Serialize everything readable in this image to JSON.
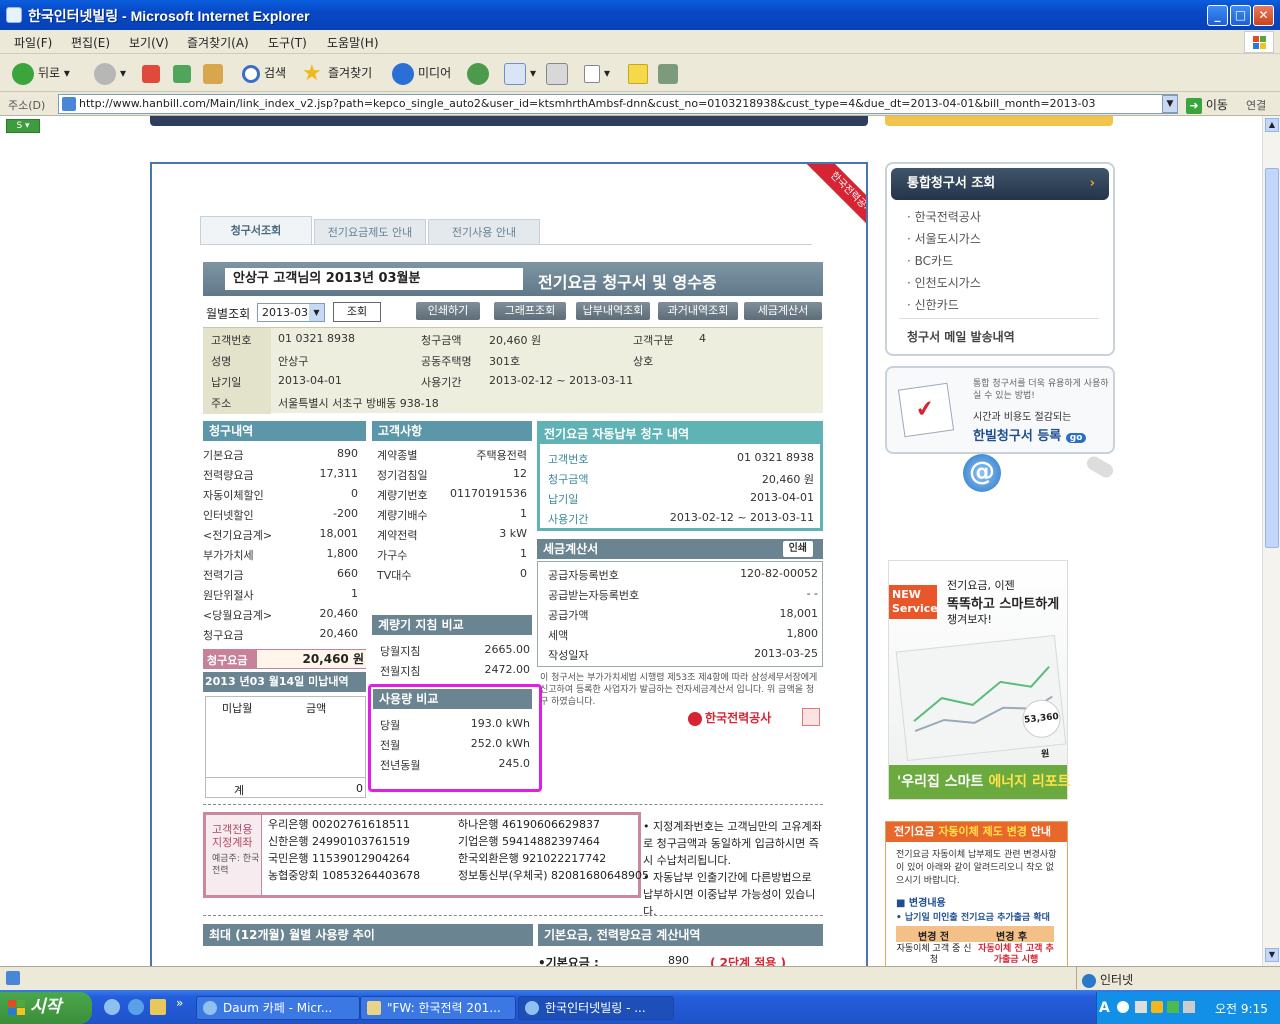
{
  "window": {
    "title": "한국인터넷빌링 - Microsoft Internet Explorer"
  },
  "menu": [
    "파일(F)",
    "편집(E)",
    "보기(V)",
    "즐겨찾기(A)",
    "도구(T)",
    "도움말(H)"
  ],
  "toolbar": {
    "back": "뒤로",
    "search": "검색",
    "favorites": "즐겨찾기",
    "media": "미디어"
  },
  "address": {
    "label": "주소(D)",
    "url": "http://www.hanbill.com/Main/link_index_v2.jsp?path=kepco_single_auto2&user_id=ktsmhrthAmbsf-dnn&cust_no=0103218938&cust_type=4&due_dt=2013-04-01&bill_month=2013-03",
    "go": "이동",
    "links": "연결"
  },
  "page": {
    "ribbon": "한국전력공사",
    "tabs": [
      "청구서조회",
      "전기요금제도 안내",
      "전기사용 안내"
    ],
    "title_customer": "안상구 고객님의 2013년 03월분",
    "title_doc": "전기요금 청구서 및 영수증",
    "month_label": "월별조회",
    "month_value": "2013-03",
    "query_btn": "조회",
    "actions": [
      "인쇄하기",
      "그래프조회",
      "납부내역조회",
      "과거내역조회",
      "세금계산서"
    ],
    "info": {
      "cust_no_label": "고객번호",
      "cust_no": "01 0321 8938",
      "bill_amt_label": "청구금액",
      "bill_amt": "20,460 원",
      "cust_type_label": "고객구분",
      "cust_type": "4",
      "name_label": "성명",
      "name": "안상구",
      "apt_label": "공동주택명",
      "apt": "301호",
      "shop_label": "상호",
      "shop": "",
      "due_label": "납기일",
      "due": "2013-04-01",
      "period_label": "사용기간",
      "period": "2013-02-12 ~ 2013-03-11",
      "addr_label": "주소",
      "addr": "서울특별시 서초구 방배동 938-18"
    },
    "charges": {
      "header": "청구내역",
      "rows": [
        {
          "label": "기본요금",
          "value": "890"
        },
        {
          "label": "전력량요금",
          "value": "17,311"
        },
        {
          "label": "자동이체할인",
          "value": "0"
        },
        {
          "label": "인터넷할인",
          "value": "-200"
        },
        {
          "label": "<전기요금계>",
          "value": "18,001"
        },
        {
          "label": "부가가치세",
          "value": "1,800"
        },
        {
          "label": "전력기금",
          "value": "660"
        },
        {
          "label": "원단위절사",
          "value": "1"
        },
        {
          "label": "<당월요금계>",
          "value": "20,460"
        },
        {
          "label": "청구요금",
          "value": "20,460"
        }
      ],
      "total_label": "청구요금",
      "total_value": "20,460 원",
      "unpaid_title": "2013 년03 월14일 미납내역",
      "unpaid_cols": [
        "미납월",
        "금액"
      ],
      "unpaid_sum_label": "계",
      "unpaid_sum_value": "0"
    },
    "customer": {
      "header": "고객사항",
      "rows": [
        {
          "label": "계약종별",
          "value": "주택용전력"
        },
        {
          "label": "정기검침일",
          "value": "12"
        },
        {
          "label": "계량기번호",
          "value": "01170191536"
        },
        {
          "label": "계량기배수",
          "value": "1"
        },
        {
          "label": "계약전력",
          "value": "3 kW"
        },
        {
          "label": "가구수",
          "value": "1"
        },
        {
          "label": "TV대수",
          "value": "0"
        }
      ]
    },
    "meter": {
      "header": "계량기 지침 비교",
      "rows": [
        {
          "label": "당월지침",
          "value": "2665.00"
        },
        {
          "label": "전월지침",
          "value": "2472.00"
        }
      ]
    },
    "usage": {
      "header": "사용량 비교",
      "rows": [
        {
          "label": "당월",
          "value": "193.0 kWh"
        },
        {
          "label": "전월",
          "value": "252.0 kWh"
        },
        {
          "label": "전년동월",
          "value": "245.0"
        }
      ]
    },
    "autopay": {
      "header": "전기요금 자동납부 청구 내역",
      "rows": [
        {
          "label": "고객번호",
          "value": "01 0321 8938"
        },
        {
          "label": "청구금액",
          "value": "20,460 원"
        },
        {
          "label": "납기일",
          "value": "2013-04-01"
        },
        {
          "label": "사용기간",
          "value": "2013-02-12 ~ 2013-03-11"
        }
      ]
    },
    "tax": {
      "header": "세금계산서",
      "print": "인쇄",
      "rows": [
        {
          "label": "공급자등록번호",
          "value": "120-82-00052"
        },
        {
          "label": "공급받는자등록번호",
          "value": "- -"
        },
        {
          "label": "공급가액",
          "value": "18,001"
        },
        {
          "label": "세액",
          "value": "1,800"
        },
        {
          "label": "작성일자",
          "value": "2013-03-25"
        }
      ],
      "note": "이 청구서는 부가가치세법 시행령 제53조 제4항에 따라 삼성세무서장에게 신고하여 등록한 사업자가 발급하는 전자세금계산서 입니다. 위 금액을 청구 하였습니다.",
      "kepco": "한국전력공사"
    },
    "bank": {
      "title": "고객전용 지정계좌",
      "holder": "예금주: 한국전력",
      "accounts": [
        "우리은행 00202761618511",
        "하나은행 46190606629837",
        "신한은행 24990103761519",
        "기업은행 59414882397464",
        "국민은행 11539012904264",
        "한국외환은행 921022217742",
        "농협중앙회 10853264403678",
        "정보통신부(우체국) 82081680648905"
      ],
      "notes": [
        "• 지정계좌번호는 고객님만의 고유계좌로 청구금액과 동일하게 입금하시면 즉시 수납처리됩니다.",
        "• 자동납부 인출기간에 다른방법으로 납부하시면 이중납부 가능성이 있습니다."
      ]
    },
    "bottom": {
      "left_header": "최대 (12개월) 월별 사용량 추이",
      "right_header": "기본요금, 전력량요금 계산내역",
      "basic_label": "•기본요금 :",
      "basic_value": "890",
      "step": "( 2단계 적용 )"
    }
  },
  "sidebar": {
    "header": "통합청구서 조회",
    "items": [
      "한국전력공사",
      "서울도시가스",
      "BC카드",
      "인천도시가스",
      "신한카드"
    ],
    "mail_history": "청구서 메일 발송내역",
    "promo_line1": "통합 청구서를 더욱 유용하게 사용하실 수 있는 방법!",
    "promo_line2": "시간과 비용도 절감되는",
    "promo_cta": "한빌청구서 등록",
    "go": "go",
    "ad_badge": "NEW Service",
    "ad_line1": "전기요금, 이젠",
    "ad_line2": "똑똑하고 스마트하게",
    "ad_line3": "챙겨보자!",
    "ad_chart_value": "53,360원",
    "ad_footer_prefix": "'우리집 스마트 ",
    "ad_footer_highlight": "에너지 리포트",
    "ad_footer_suffix": "'",
    "notice_header_a": "전기요금 ",
    "notice_header_b": "자동이체 제도 변경",
    "notice_header_c": " 안내",
    "notice_body": "전기요금 자동이체 납부제도 관련 변경사항이 있어 아래와 같이 알려드리오니 착오 없으시기 바랍니다.",
    "notice_sub": "■ 변경내용",
    "notice_item": "• 납기일 미인출 전기요금 추가출금 확대",
    "notice_cols": [
      "변경 전",
      "변경 후"
    ],
    "notice_before": "자동이체 고객 중 신청",
    "notice_after": "자동이체 전 고객 추가출금 시행"
  },
  "status": {
    "zone": "인터넷"
  },
  "taskbar": {
    "start": "시작",
    "tasks": [
      "Daum 카페 - Micr...",
      "\"FW: 한국전력 201...",
      "한국인터넷빌링 - ..."
    ],
    "clock": "오전 9:15"
  }
}
